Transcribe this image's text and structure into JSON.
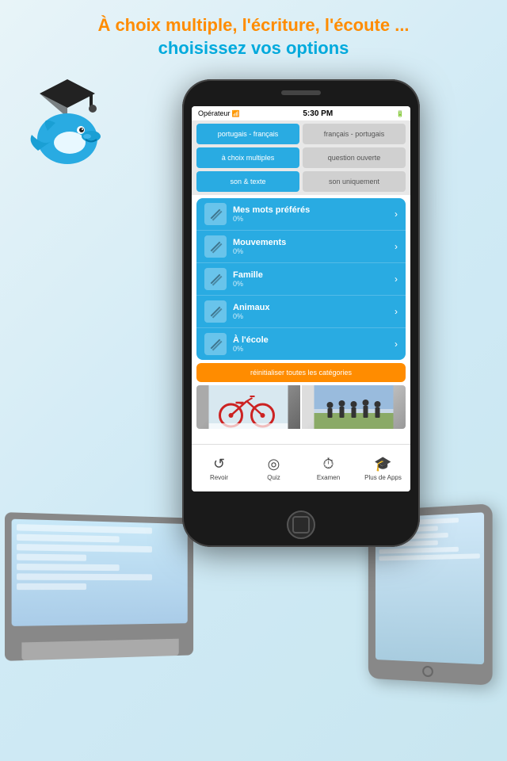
{
  "header": {
    "line1": "À choix multiple, l'écriture, l'écoute ...",
    "line2": "choisissez vos options"
  },
  "phone": {
    "status": {
      "carrier": "Opérateur",
      "wifi": "▾",
      "time": "5:30 PM",
      "battery": "▮"
    },
    "toggles": [
      {
        "row": [
          {
            "label": "portugais - français",
            "active": true
          },
          {
            "label": "français - portugais",
            "active": false
          }
        ]
      },
      {
        "row": [
          {
            "label": "à choix multiples",
            "active": true
          },
          {
            "label": "question ouverte",
            "active": false
          }
        ]
      },
      {
        "row": [
          {
            "label": "son & texte",
            "active": true
          },
          {
            "label": "son uniquement",
            "active": false
          }
        ]
      }
    ],
    "categories": [
      {
        "name": "Mes mots préférés",
        "percent": "0%"
      },
      {
        "name": "Mouvements",
        "percent": "0%"
      },
      {
        "name": "Famille",
        "percent": "0%"
      },
      {
        "name": "Animaux",
        "percent": "0%"
      },
      {
        "name": "À l'école",
        "percent": "0%"
      }
    ],
    "reset_button": "réinitialiser toutes les catégories",
    "tabs": [
      {
        "icon": "↺",
        "label": "Revoir"
      },
      {
        "icon": "◎",
        "label": "Quiz"
      },
      {
        "icon": "⏱",
        "label": "Examen"
      },
      {
        "icon": "🎓",
        "label": "Plus de Apps"
      }
    ]
  }
}
